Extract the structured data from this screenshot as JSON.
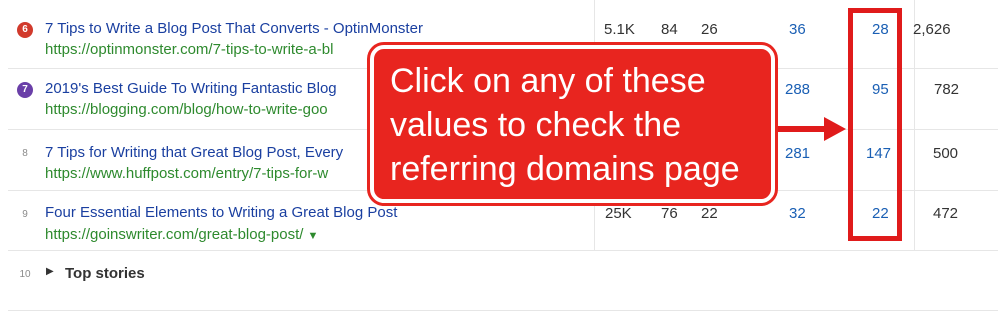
{
  "results": [
    {
      "rank": "6",
      "title": "7 Tips to Write a Blog Post That Converts - OptinMonster",
      "url": "https://optinmonster.com/7-tips-to-write-a-bl",
      "c1": "5.1K",
      "c2": "84",
      "c3": "26",
      "c4": "36",
      "rd": "28",
      "c6": "2,626"
    },
    {
      "rank": "7",
      "title": "2019's Best Guide To Writing Fantastic Blog",
      "url": "https://blogging.com/blog/how-to-write-goo",
      "c4": "288",
      "rd": "95",
      "c6": "782"
    },
    {
      "rank": "8",
      "title": "7 Tips for Writing that Great Blog Post, Every",
      "url": "https://www.huffpost.com/entry/7-tips-for-w",
      "c4": "281",
      "rd": "147",
      "c6": "500"
    },
    {
      "rank": "9",
      "title": "Four Essential Elements to Writing a Great Blog Post",
      "url": "https://goinswriter.com/great-blog-post/",
      "c1": "25K",
      "c2": "76",
      "c3": "22",
      "c4": "32",
      "rd": "22",
      "c6": "472"
    }
  ],
  "top_stories": {
    "rank": "10",
    "label": "Top stories"
  },
  "callout": {
    "line1": "Click on any of these",
    "line2": "values to check the",
    "line3": "referring domains page"
  },
  "colors": {
    "accent_red": "#e01b1b",
    "rank6": "#d13a2c",
    "rank7": "#6a3fa8",
    "link": "#1a3fa0",
    "url": "#2e8a2e"
  }
}
